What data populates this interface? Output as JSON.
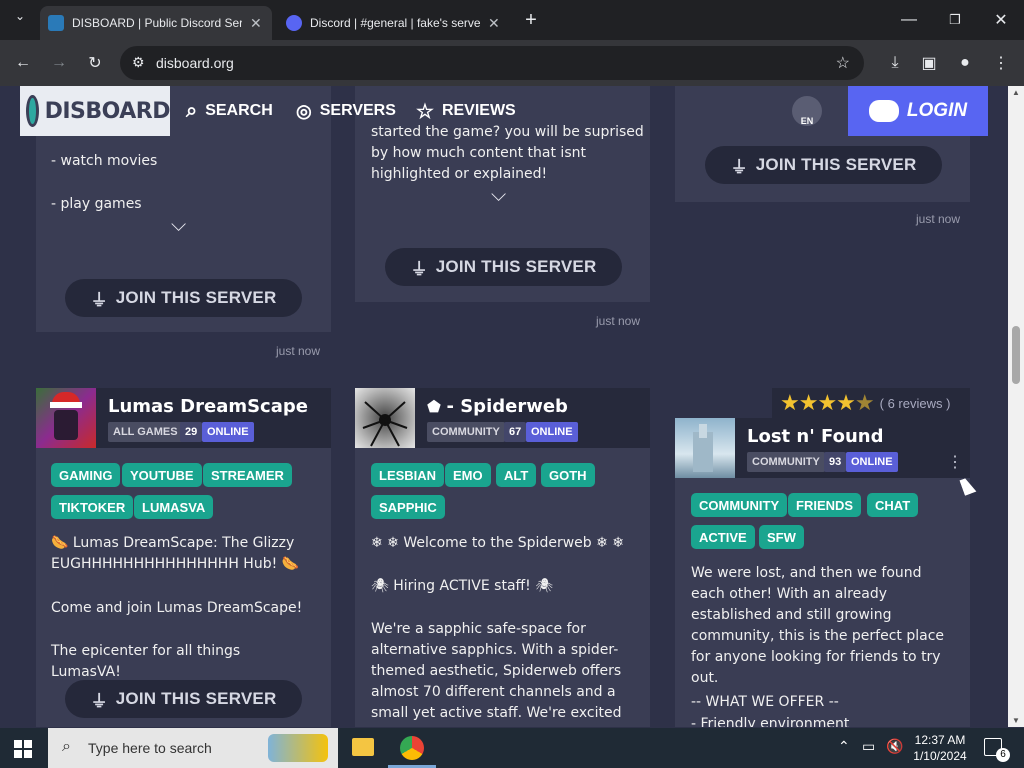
{
  "browser": {
    "tabs": [
      {
        "title": "DISBOARD | Public Discord Serv",
        "active": true
      },
      {
        "title": "Discord | #general | fake's serve",
        "active": false
      }
    ],
    "url": "disboard.org"
  },
  "nav": {
    "logo": "DISBOARD",
    "search": "SEARCH",
    "servers": "SERVERS",
    "reviews": "REVIEWS",
    "lang": "EN",
    "login": "LOGIN"
  },
  "top_cards": [
    {
      "lines": [
        "- watch movies",
        "- play games"
      ],
      "join": "JOIN THIS SERVER",
      "time": "just now"
    },
    {
      "lines": [
        "started the game? you will be suprised",
        "by how much content that isnt",
        "highlighted or explained!"
      ],
      "join": "JOIN THIS SERVER",
      "time": "just now"
    },
    {
      "join": "JOIN THIS SERVER",
      "time": "just now"
    }
  ],
  "servers": [
    {
      "name": "Lumas DreamScape",
      "category": "ALL GAMES",
      "online_count": "29",
      "online_label": "ONLINE",
      "tags": [
        "GAMING",
        "YOUTUBE",
        "STREAMER",
        "TIKTOKER",
        "LUMASVA"
      ],
      "desc": [
        "🌭 Lumas DreamScape: The Glizzy EUGHHHHHHHHHHHHHHH Hub! 🌭",
        "Come and join Lumas DreamScape!",
        "The epicenter for all things LumasVA!"
      ],
      "join": "JOIN THIS SERVER"
    },
    {
      "name": "- Spiderweb",
      "category": "COMMUNITY",
      "online_count": "67",
      "online_label": "ONLINE",
      "tags": [
        "LESBIAN",
        "EMO",
        "ALT",
        "GOTH",
        "SAPPHIC"
      ],
      "desc": [
        "❄ ❄ Welcome to the Spiderweb ❄ ❄",
        "🕷 Hiring ACTIVE staff! 🕷",
        "We're a sapphic safe-space for alternative sapphics. With a spider-themed aesthetic, Spiderweb offers almost 70 different channels and a small yet active staff. We're excited to get to"
      ]
    },
    {
      "name": "Lost n' Found",
      "category": "COMMUNITY",
      "online_count": "93",
      "online_label": "ONLINE",
      "rating": 4.5,
      "reviews": "( 6 reviews )",
      "tags": [
        "COMMUNITY",
        "FRIENDS",
        "CHAT",
        "ACTIVE",
        "SFW"
      ],
      "desc": [
        "We were lost, and then we found each other! With an already established and still growing community, this is the perfect place for anyone looking for friends to try out.",
        "-- WHAT WE OFFER --",
        "- Friendly environment"
      ]
    }
  ],
  "taskbar": {
    "search_placeholder": "Type here to search",
    "time": "12:37 AM",
    "date": "1/10/2024",
    "notif_count": "6"
  }
}
